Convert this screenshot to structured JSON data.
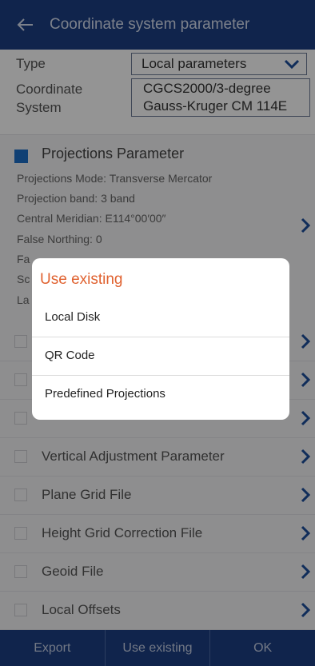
{
  "header": {
    "title": "Coordinate system parameter"
  },
  "form": {
    "type_label": "Type",
    "type_value": "Local parameters",
    "coord_label_1": "Coordinate",
    "coord_label_2": "System",
    "coord_value_1": "CGCS2000/3-degree",
    "coord_value_2": "Gauss-Kruger CM 114E"
  },
  "projection": {
    "title": "Projections Parameter",
    "lines": [
      "Projections Mode: Transverse Mercator",
      "Projection band: 3 band",
      "Central Meridian: E114°00′00″",
      "False Northing: 0",
      "Fa",
      "Sc",
      "La"
    ]
  },
  "list": [
    {
      "label": ""
    },
    {
      "label": ""
    },
    {
      "label": ""
    },
    {
      "label": "Vertical Adjustment Parameter"
    },
    {
      "label": "Plane Grid File"
    },
    {
      "label": "Height Grid Correction File"
    },
    {
      "label": "Geoid File"
    },
    {
      "label": "Local Offsets"
    }
  ],
  "footer": {
    "export": "Export",
    "use_existing": "Use existing",
    "ok": "OK"
  },
  "dialog": {
    "title": "Use existing",
    "items": [
      "Local Disk",
      "QR Code",
      "Predefined Projections"
    ]
  },
  "colors": {
    "header_bg": "#1d3f84",
    "dialog_title": "#e06230",
    "checkbox_checked": "#1d6ec9",
    "chevron": "#1d4f9c"
  },
  "icons": [
    "back-arrow-icon",
    "chevron-down-icon",
    "chevron-right-icon",
    "checkbox-icon"
  ]
}
